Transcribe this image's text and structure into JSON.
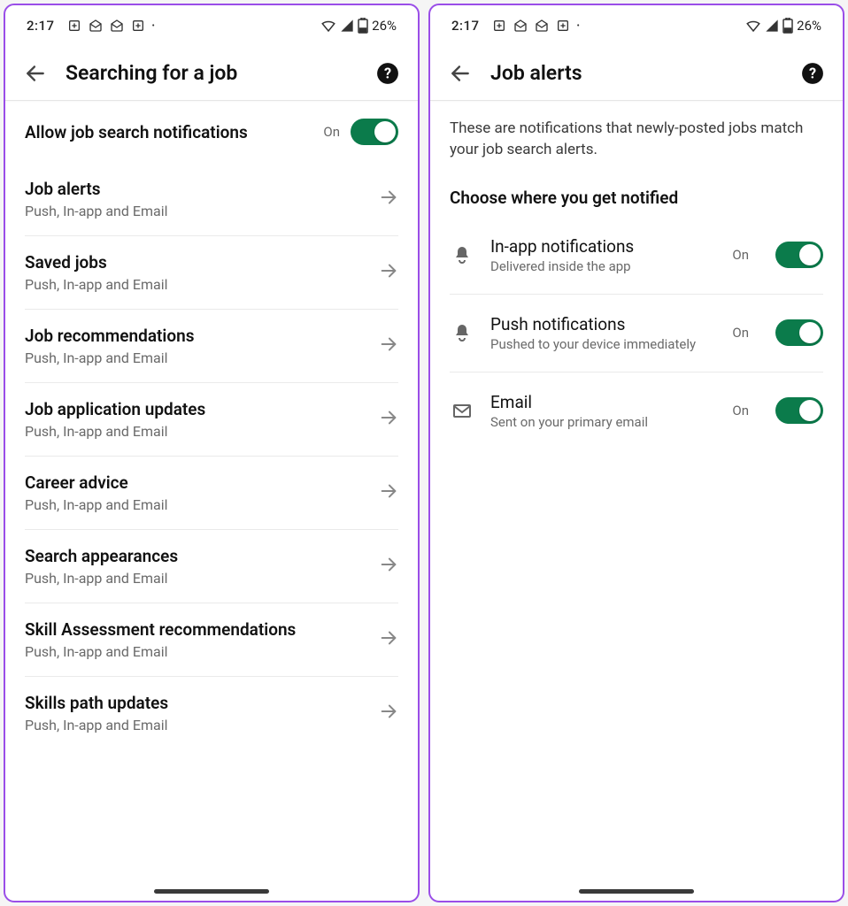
{
  "status": {
    "time": "2:17",
    "battery": "26%"
  },
  "left": {
    "title": "Searching for a job",
    "allowLabel": "Allow job search notifications",
    "allowState": "On",
    "items": [
      {
        "title": "Job alerts",
        "sub": "Push, In-app and Email"
      },
      {
        "title": "Saved jobs",
        "sub": "Push, In-app and Email"
      },
      {
        "title": "Job recommendations",
        "sub": "Push, In-app and Email"
      },
      {
        "title": "Job application updates",
        "sub": "Push, In-app and Email"
      },
      {
        "title": "Career advice",
        "sub": "Push, In-app and Email"
      },
      {
        "title": "Search appearances",
        "sub": "Push, In-app and Email"
      },
      {
        "title": "Skill Assessment recommendations",
        "sub": "Push, In-app and Email"
      },
      {
        "title": "Skills path updates",
        "sub": "Push, In-app and Email"
      }
    ]
  },
  "right": {
    "title": "Job alerts",
    "intro": "These are notifications that newly-posted jobs match your job search alerts.",
    "sectionHeader": "Choose where you get notified",
    "channels": [
      {
        "icon": "bell",
        "title": "In-app notifications",
        "sub": "Delivered inside the app",
        "state": "On"
      },
      {
        "icon": "bell",
        "title": "Push notifications",
        "sub": "Pushed to your device immediately",
        "state": "On"
      },
      {
        "icon": "mail",
        "title": "Email",
        "sub": "Sent on your primary email",
        "state": "On"
      }
    ]
  }
}
